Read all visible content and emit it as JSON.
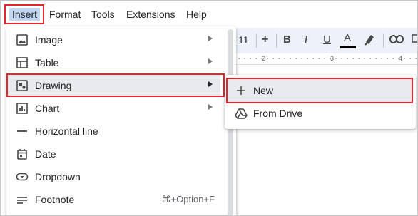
{
  "menubar": {
    "items": [
      "Insert",
      "Format",
      "Tools",
      "Extensions",
      "Help"
    ]
  },
  "toolbar": {
    "font_size": "11",
    "plus": "+",
    "bold": "B",
    "italic": "I",
    "underline": "U",
    "text_color": "A",
    "ruler_marks": [
      "2",
      "3",
      "4"
    ]
  },
  "insert_menu": {
    "items": [
      {
        "label": "Image",
        "icon": "image-icon",
        "has_submenu": true
      },
      {
        "label": "Table",
        "icon": "table-icon",
        "has_submenu": true
      },
      {
        "label": "Drawing",
        "icon": "drawing-icon",
        "has_submenu": true,
        "selected": true
      },
      {
        "label": "Chart",
        "icon": "chart-icon",
        "has_submenu": true
      },
      {
        "label": "Horizontal line",
        "icon": "horizontal-line-icon",
        "has_submenu": false
      },
      {
        "label": "Date",
        "icon": "calendar-icon",
        "has_submenu": false
      },
      {
        "label": "Dropdown",
        "icon": "dropdown-icon",
        "has_submenu": false
      },
      {
        "label": "Footnote",
        "icon": "footnote-icon",
        "has_submenu": false,
        "shortcut": "⌘+Option+F"
      }
    ]
  },
  "drawing_submenu": {
    "items": [
      {
        "label": "New",
        "icon": "plus-icon",
        "selected": true
      },
      {
        "label": "From Drive",
        "icon": "google-drive-icon"
      }
    ]
  },
  "colors": {
    "highlight_border": "#e8242d",
    "active_menu_bg": "#c2d7f2",
    "selected_row_bg": "#e8eaed",
    "toolbar_bg": "#edf2fa"
  }
}
